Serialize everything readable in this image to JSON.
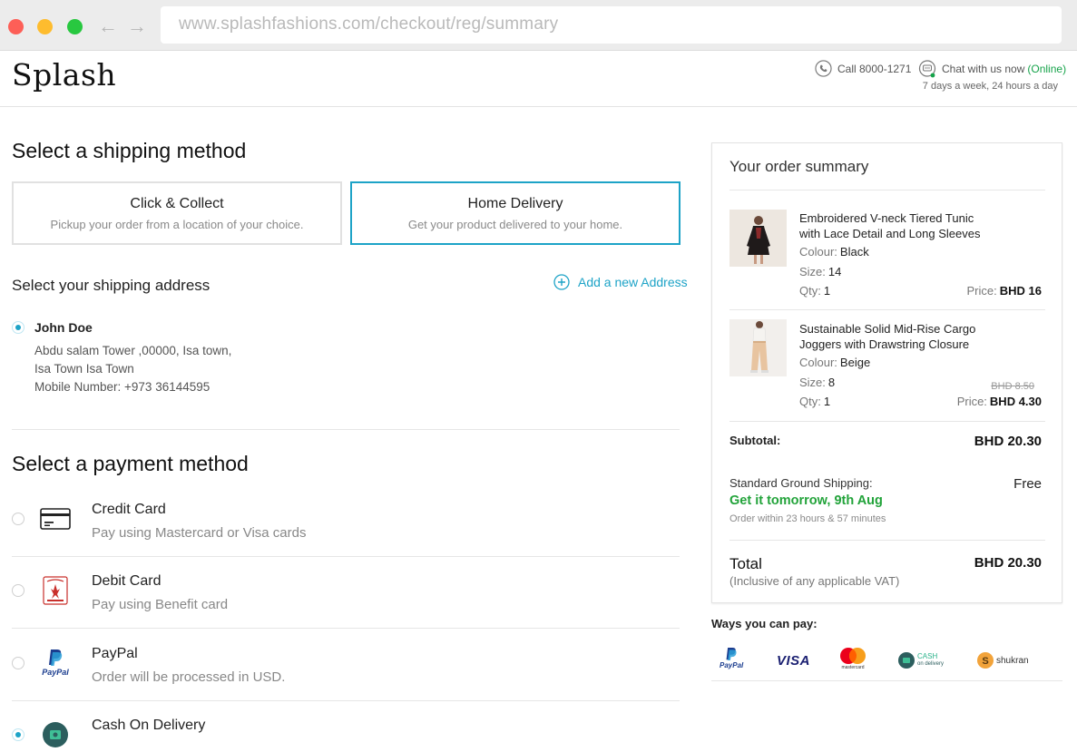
{
  "browser": {
    "url": "www.splashfashions.com/checkout/reg/summary"
  },
  "header": {
    "logo": "Splash",
    "call": "Call 8000-1271",
    "chat": "Chat with us now",
    "chat_status": "(Online)",
    "hours": "7 days a week, 24 hours a day"
  },
  "shipping": {
    "title": "Select a shipping method",
    "options": [
      {
        "title": "Click & Collect",
        "subtitle": "Pickup your order from a location of your choice.",
        "selected": false
      },
      {
        "title": "Home Delivery",
        "subtitle": "Get your product delivered to your home.",
        "selected": true
      }
    ]
  },
  "address": {
    "title": "Select your shipping address",
    "add_label": "Add a new Address",
    "name": "John Doe",
    "line1": "Abdu salam Tower ,00000, Isa town,",
    "line2": "Isa Town Isa Town",
    "mobile": "Mobile Number: +973 36144595"
  },
  "payment": {
    "title": "Select a payment method",
    "methods": [
      {
        "name": "Credit Card",
        "desc": "Pay using Mastercard or Visa cards",
        "icon": "credit-card-icon",
        "selected": false
      },
      {
        "name": "Debit Card",
        "desc": "Pay using Benefit card",
        "icon": "benefit-card-icon",
        "selected": false
      },
      {
        "name": "PayPal",
        "desc": "Order will be processed in USD.",
        "icon": "paypal-icon",
        "selected": false
      },
      {
        "name": "Cash On Delivery",
        "desc": "",
        "icon": "cash-icon",
        "selected": true
      }
    ],
    "paypal_mark": "PayPal"
  },
  "summary": {
    "title": "Your order summary",
    "items": [
      {
        "name": "Embroidered V-neck Tiered Tunic with Lace Detail and Long Sleeves",
        "colour_label": "Colour:",
        "colour": "Black",
        "size_label": "Size:",
        "size": "14",
        "qty_label": "Qty:",
        "qty": "1",
        "price_label": "Price:",
        "price": "BHD 16",
        "old_price": ""
      },
      {
        "name": "Sustainable Solid Mid-Rise Cargo Joggers with Drawstring Closure",
        "colour_label": "Colour:",
        "colour": "Beige",
        "size_label": "Size:",
        "size": "8",
        "qty_label": "Qty:",
        "qty": "1",
        "price_label": "Price:",
        "price": "BHD 4.30",
        "old_price": "BHD 8.50"
      }
    ],
    "subtotal_label": "Subtotal:",
    "subtotal": "BHD 20.30",
    "shipping_label": "Standard Ground Shipping:",
    "shipping_cost": "Free",
    "shipping_eta": "Get it tomorrow, 9th Aug",
    "shipping_order_within": "Order within 23 hours & 57 minutes",
    "total_label": "Total",
    "total_sub": "(Inclusive of any applicable VAT)",
    "total": "BHD 20.30"
  },
  "ways_to_pay": {
    "title": "Ways you can pay:",
    "brands": [
      "PayPal",
      "VISA",
      "mastercard",
      "CASH",
      "on delivery",
      "shukran"
    ]
  },
  "colors": {
    "accent": "#1da3c7",
    "success": "#22a33a",
    "online": "#16a34a"
  }
}
